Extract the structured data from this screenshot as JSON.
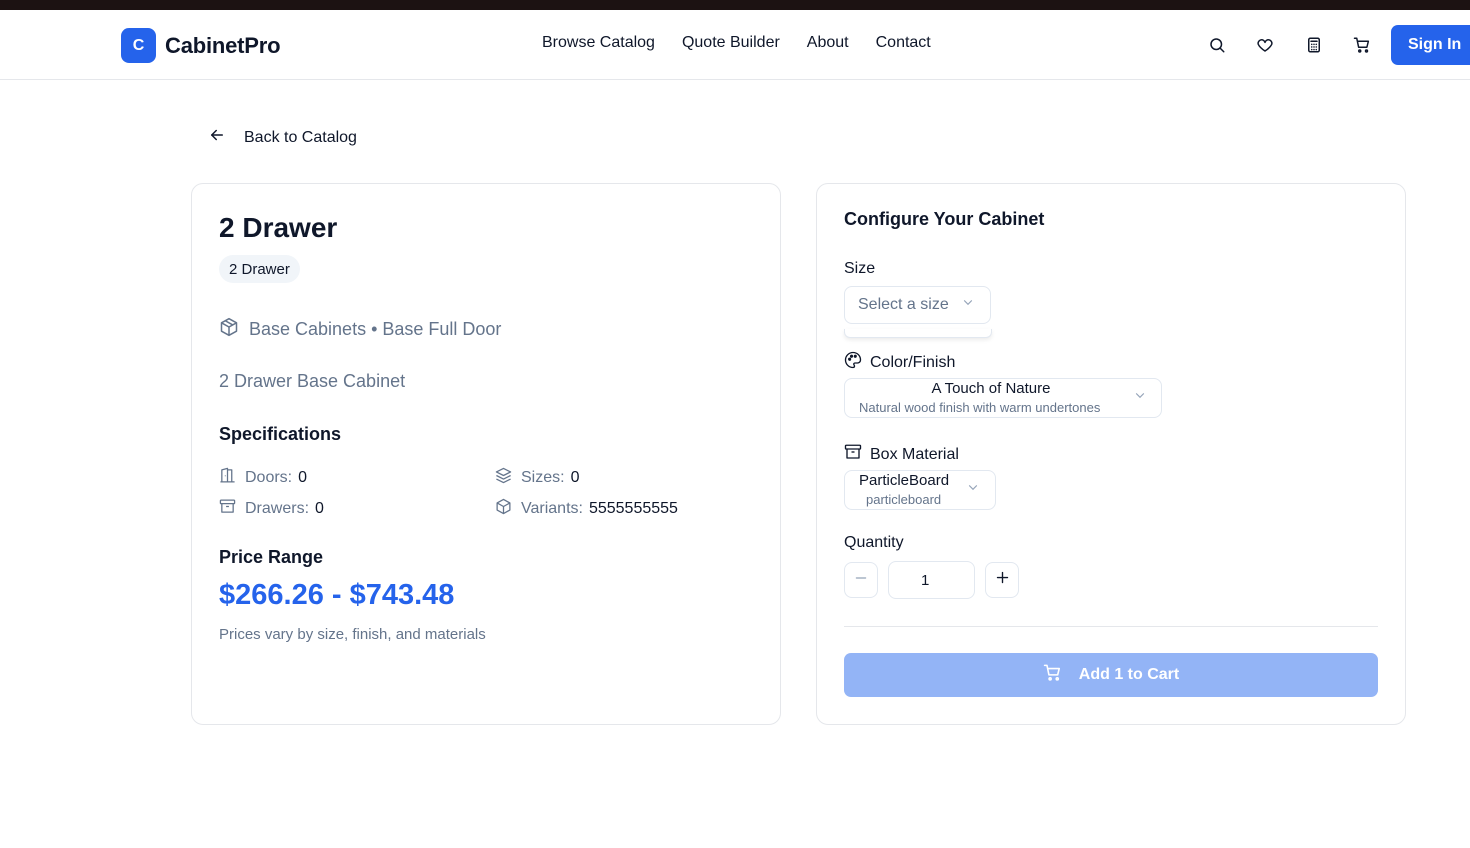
{
  "brand": {
    "logo_letter": "C",
    "name": "CabinetPro",
    "accent": "#2563eb"
  },
  "nav": {
    "links": [
      "Browse Catalog",
      "Quote Builder",
      "About",
      "Contact"
    ],
    "icons": [
      "search-icon",
      "heart-icon",
      "calculator-icon",
      "cart-icon"
    ],
    "signin_label": "Sign In"
  },
  "back": {
    "label": "Back to Catalog",
    "icon": "arrow-left-icon"
  },
  "product": {
    "title": "2 Drawer",
    "badge": "2 Drawer",
    "category": "Base Cabinets • Base Full Door",
    "description": "2 Drawer Base Cabinet",
    "specs_title": "Specifications",
    "specs": [
      {
        "label": "Doors:",
        "value": "0",
        "icon": "door-icon"
      },
      {
        "label": "Sizes:",
        "value": "0",
        "icon": "layers-icon"
      },
      {
        "label": "Drawers:",
        "value": "0",
        "icon": "archive-icon"
      },
      {
        "label": "Variants:",
        "value": "5555555555",
        "icon": "box-icon"
      }
    ],
    "price_title": "Price Range",
    "price_range": "$266.26 - $743.48",
    "price_note": "Prices vary by size, finish, and materials"
  },
  "configure": {
    "title": "Configure Your Cabinet",
    "size": {
      "label": "Size",
      "placeholder": "Select a size"
    },
    "color": {
      "label": "Color/Finish",
      "value": "A Touch of Nature",
      "description": "Natural wood finish with warm undertones"
    },
    "box": {
      "label": "Box Material",
      "value": "ParticleBoard",
      "description": "particleboard"
    },
    "quantity": {
      "label": "Quantity",
      "value": "1"
    },
    "add_label": "Add 1 to Cart"
  }
}
